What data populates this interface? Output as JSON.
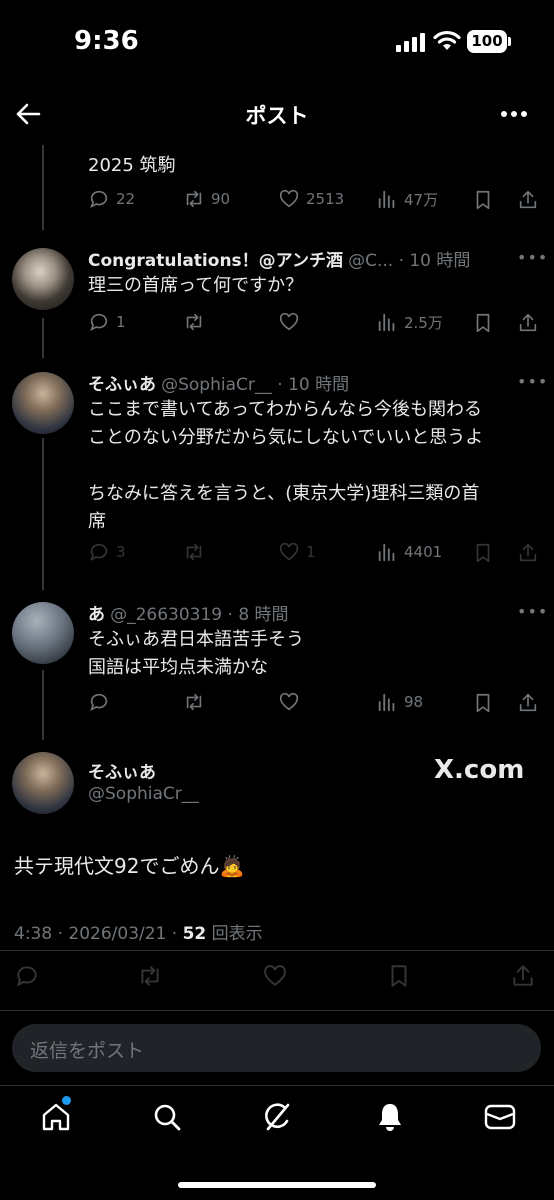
{
  "status": {
    "time": "9:36",
    "battery": "100"
  },
  "header": {
    "title": "ポスト"
  },
  "first_post": {
    "text_tail": "2025 筑駒",
    "replies": "22",
    "reposts": "90",
    "likes": "2513",
    "views": "47万"
  },
  "replies": [
    {
      "name": "Congratulations！@アンチ酒",
      "meta": "@C... · 10 時間",
      "text": "理三の首席って何ですか？",
      "replies": "1",
      "reposts": "",
      "likes": "",
      "views": "2.5万"
    },
    {
      "name": "そふぃあ",
      "meta": "@SophiaCr__ · 10 時間",
      "text": "ここまで書いてあってわからんなら今後も関わる\nことのない分野だから気にしないでいいと思うよ\n\nちなみに答えを言うと、(東京大学)理科三類の首\n席",
      "replies": "3",
      "reposts": "",
      "likes": "1",
      "views": "4401"
    },
    {
      "name": "あ",
      "meta": "@_26630319 · 8 時間",
      "text": "そふぃあ君日本語苦手そう\n国語は平均点未満かな",
      "replies": "",
      "reposts": "",
      "likes": "",
      "views": "98"
    }
  ],
  "main_post": {
    "name": "そふぃあ",
    "handle": "@SophiaCr__",
    "watermark": "X.com",
    "text": "共テ現代文92でごめん🙇",
    "timestamp": "4:38 · 2026/03/21 · ",
    "view_count": "52",
    "view_label": " 回表示"
  },
  "reply_input": {
    "placeholder": "返信をポスト"
  },
  "colors": {
    "background": "#000000",
    "text": "#e7e9ea",
    "muted": "#71767b",
    "accent": "#1d9bf0"
  }
}
